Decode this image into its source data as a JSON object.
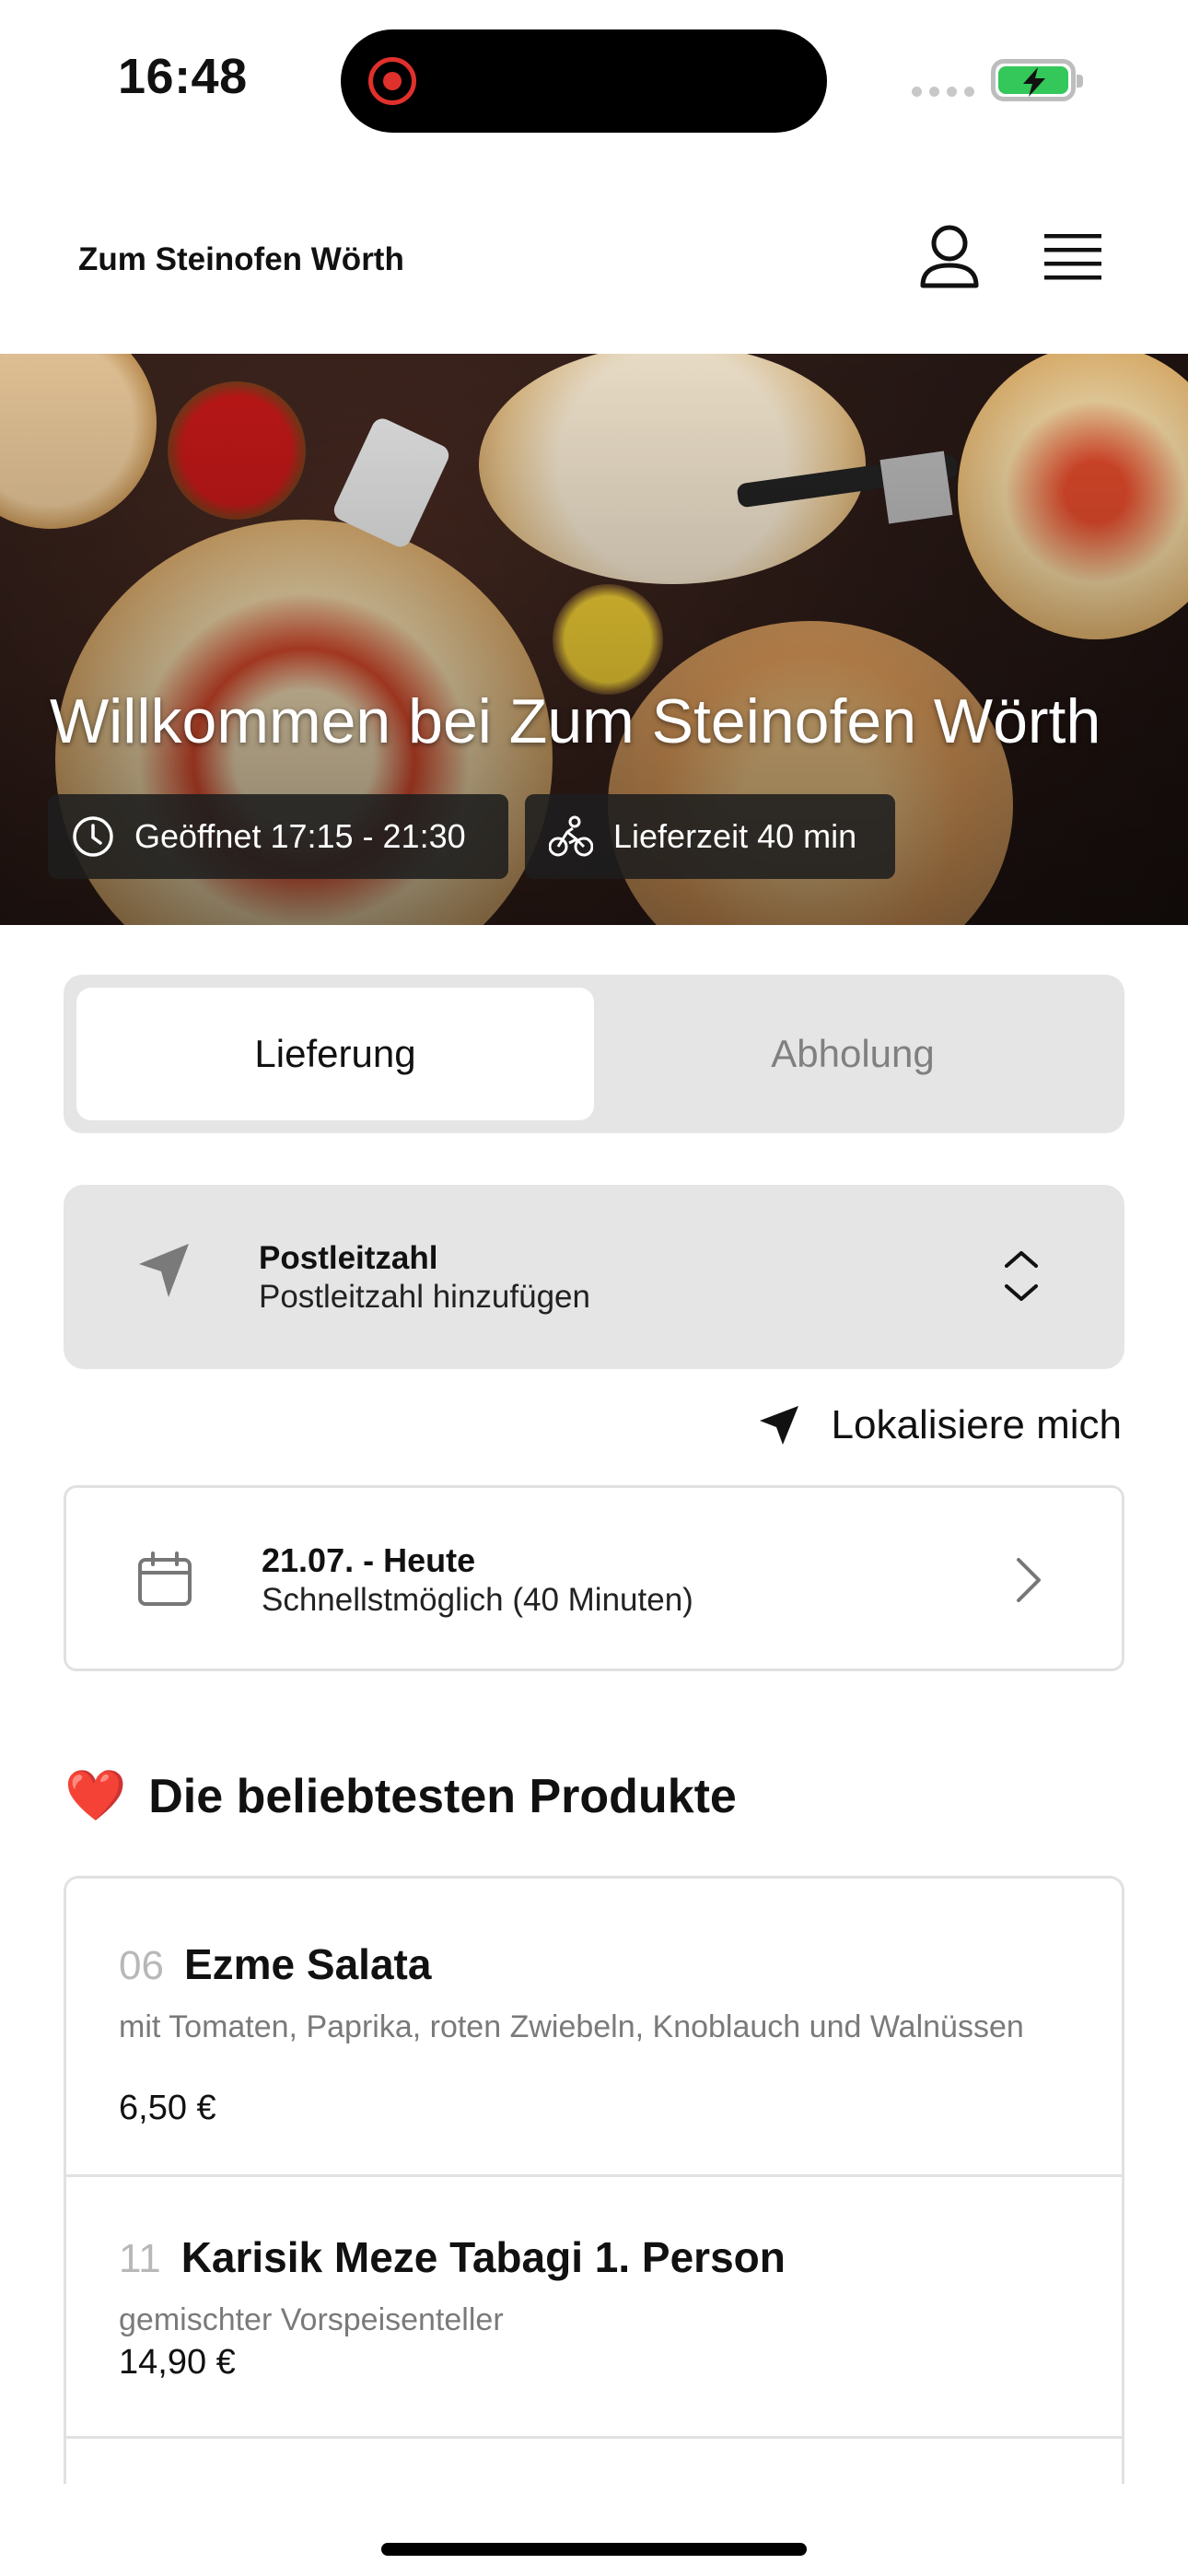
{
  "status_bar": {
    "time": "16:48",
    "battery_color": "#34c759",
    "recording_color": "#e0302c"
  },
  "header": {
    "brand": "Zum Steinofen Wörth",
    "icons": [
      "user-icon",
      "menu-icon"
    ]
  },
  "hero": {
    "title": "Willkommen bei Zum Steinofen Wörth",
    "opening_hours": "Geöffnet 17:15 - 21:30",
    "delivery_time": "Lieferzeit 40 min"
  },
  "order_mode": {
    "options": [
      "Lieferung",
      "Abholung"
    ],
    "selected": "Lieferung"
  },
  "postcode": {
    "label": "Postleitzahl",
    "placeholder": "Postleitzahl hinzufügen"
  },
  "locate": {
    "label": "Lokalisiere mich"
  },
  "schedule": {
    "date": "21.07. - Heute",
    "time": "Schnellstmöglich (40 Minuten)"
  },
  "popular": {
    "emoji": "❤️",
    "title": "Die beliebtesten Produkte",
    "items": [
      {
        "number": "06",
        "name": "Ezme Salata",
        "description": "mit Tomaten, Paprika, roten Zwiebeln, Knoblauch und Walnüssen",
        "price": "6,50 €"
      },
      {
        "number": "11",
        "name": "Karisik Meze Tabagi 1. Person",
        "description": "gemischter Vorspeisenteller",
        "price": "14,90 €"
      }
    ]
  }
}
